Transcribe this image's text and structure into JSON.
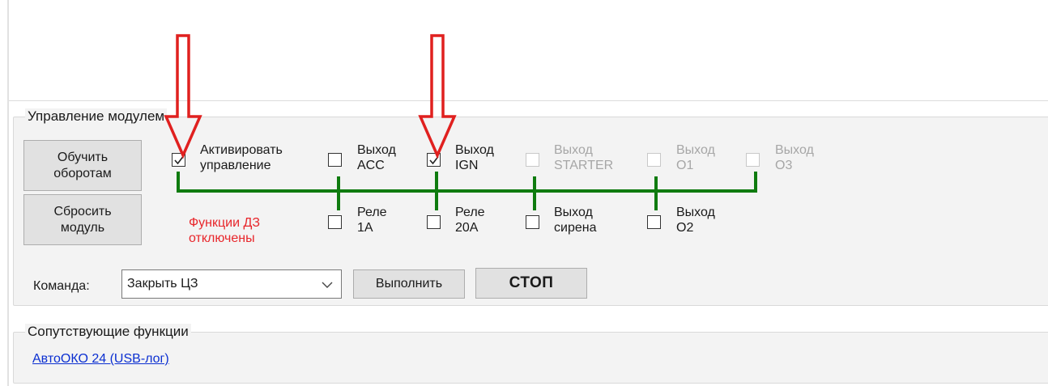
{
  "module_control": {
    "title": "Управление модулем",
    "learn_button": "Обучить оборотам",
    "reset_button": "Сбросить модуль",
    "dz_functions_status": "Функции ДЗ отключены",
    "activate": {
      "line1": "Активировать",
      "line2": "управление",
      "checked": true
    },
    "outputs_top": [
      {
        "line1": "Выход",
        "line2": "ACC",
        "checked": false,
        "enabled": true
      },
      {
        "line1": "Выход",
        "line2": "IGN",
        "checked": true,
        "enabled": true
      },
      {
        "line1": "Выход",
        "line2": "STARTER",
        "checked": false,
        "enabled": false
      },
      {
        "line1": "Выход",
        "line2": "O1",
        "checked": false,
        "enabled": false
      },
      {
        "line1": "Выход",
        "line2": "O3",
        "checked": false,
        "enabled": false
      }
    ],
    "outputs_bottom": [
      {
        "line1": "Реле",
        "line2": "1A",
        "checked": false
      },
      {
        "line1": "Реле",
        "line2": "20A",
        "checked": false
      },
      {
        "line1": "Выход",
        "line2": "сирена",
        "checked": false
      },
      {
        "line1": "Выход",
        "line2": "O2",
        "checked": false
      }
    ],
    "command_label": "Команда:",
    "command_value": "Закрыть ЦЗ",
    "execute_button": "Выполнить",
    "stop_button": "СТОП"
  },
  "related": {
    "title": "Сопутствующие функции",
    "link": "АвтоОКО 24 (USB-лог)"
  },
  "colors": {
    "annotation_arrow": "#e0201f",
    "link_line": "#0f7b0f",
    "dz_text": "#e8262b"
  }
}
